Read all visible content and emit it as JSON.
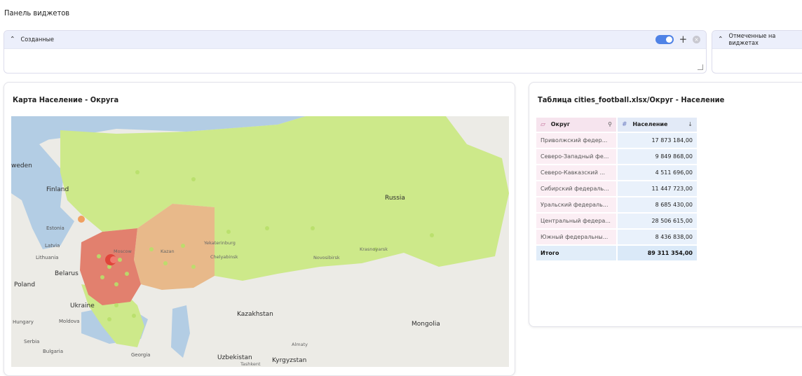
{
  "page": {
    "title": "Панель виджетов"
  },
  "sections": {
    "created": {
      "title": "Созданные",
      "toggle_on": true
    },
    "marked": {
      "title": "Отмеченные на виджетах"
    }
  },
  "map_widget": {
    "title": "Карта Население - Округа",
    "labels": {
      "sweden": "weden",
      "finland": "Finland",
      "russia": "Russia",
      "estonia": "Estonia",
      "latvia": "Latvia",
      "lithuania": "Lithuania",
      "belarus": "Belarus",
      "poland": "Poland",
      "ukraine": "Ukraine",
      "moldova": "Moldova",
      "hungary": "Hungary",
      "serbia": "Serbia",
      "bulgaria": "Bulgaria",
      "georgia": "Georgia",
      "kazakhstan": "Kazakhstan",
      "uzbekistan": "Uzbekistan",
      "kyrgyzstan": "Kyrgyzstan",
      "mongolia": "Mongolia",
      "moscow": "Moscow",
      "kazan": "Kazan",
      "yekaterinburg": "Yekaterinburg",
      "chelyabinsk": "Chelyabinsk",
      "novosibirsk": "Novosibirsk",
      "krasnoyarsk": "Krasnoyarsk",
      "almaty": "Almaty",
      "tashkent": "Tashkent"
    },
    "colors": {
      "low": "#cde98a",
      "mid": "#e8b98a",
      "high": "#e2806e",
      "water": "#b3cde4",
      "land": "#ecebe6"
    }
  },
  "table_widget": {
    "title": "Таблица cities_football.xlsx/Округ - Население",
    "columns": {
      "region": "Округ",
      "population": "Население",
      "sort_icon": "arrow-down-icon"
    },
    "rows": [
      {
        "region": "Приволжский федер...",
        "population": "17 873 184,00"
      },
      {
        "region": "Северо-Западный фе...",
        "population": "9 849 868,00"
      },
      {
        "region": "Северо-Кавказский ...",
        "population": "4 511 696,00"
      },
      {
        "region": "Сибирский федераль...",
        "population": "11 447 723,00"
      },
      {
        "region": "Уральский федераль...",
        "population": "8 685 430,00"
      },
      {
        "region": "Центральный федера...",
        "population": "28 506 615,00"
      },
      {
        "region": "Южный федеральны...",
        "population": "8 436 838,00"
      }
    ],
    "total": {
      "label": "Итого",
      "value": "89 311 354,00"
    }
  }
}
